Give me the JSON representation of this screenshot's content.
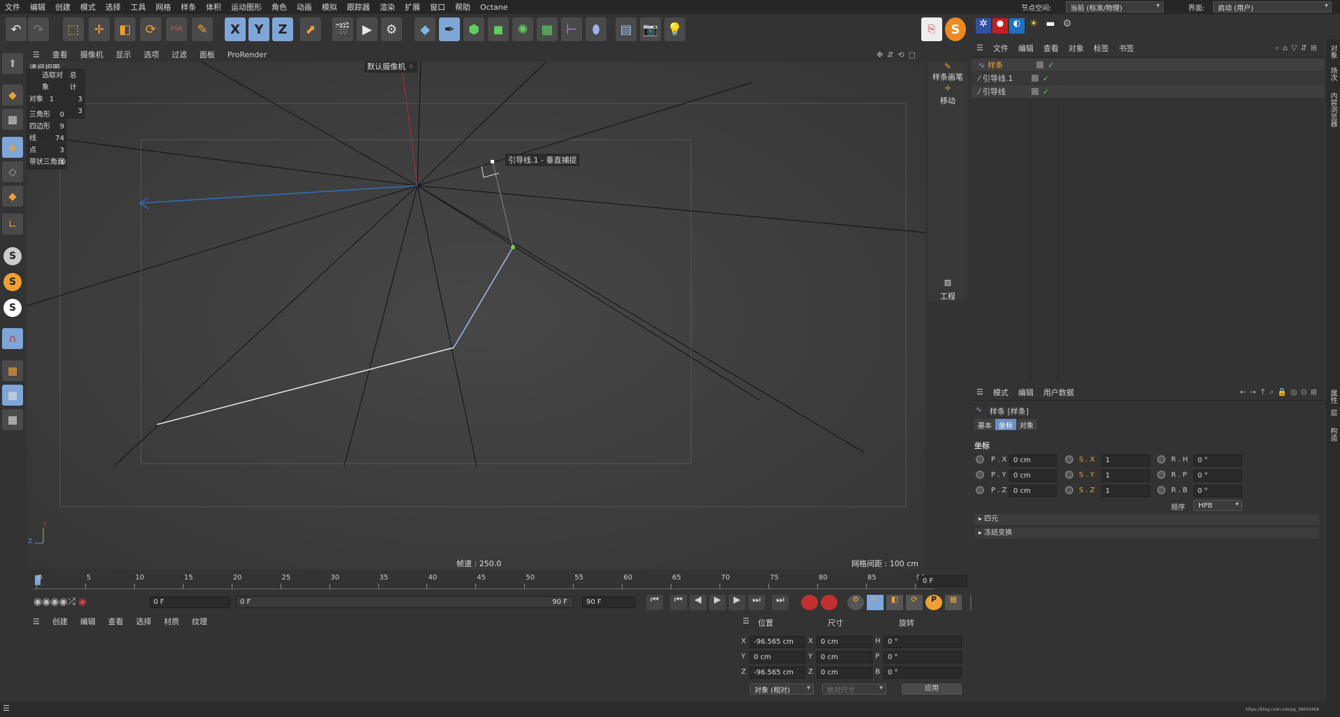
{
  "menubar": {
    "items": [
      "文件",
      "编辑",
      "创建",
      "模式",
      "选择",
      "工具",
      "网格",
      "样条",
      "体积",
      "运动图形",
      "角色",
      "动画",
      "模拟",
      "跟踪器",
      "渲染",
      "扩展",
      "窗口",
      "帮助",
      "Octane"
    ],
    "node_space_label": "节点空间:",
    "node_space_value": "当前 (标准/物理)",
    "layout_label": "界面:",
    "layout_value": "启动 (用户)"
  },
  "toolbar": {
    "icons": [
      "undo-icon",
      "redo-icon",
      "select-icon",
      "move-icon",
      "scale-icon",
      "rotate-icon",
      "psr-icon",
      "spline-pen-icon",
      "x-axis-icon",
      "y-axis-icon",
      "z-axis-icon",
      "coordinate-system-icon",
      "render-view-icon",
      "render-icon",
      "render-settings-icon",
      "cube-icon",
      "pen-icon",
      "subdivision-icon",
      "extrude-icon",
      "cloner-icon",
      "array-icon",
      "deformer-icon",
      "bend-icon",
      "floor-icon",
      "camera-icon",
      "light-icon"
    ],
    "axis_labels": [
      "X",
      "Y",
      "Z"
    ],
    "psr_label": "PSR"
  },
  "viewport": {
    "menu": [
      "查看",
      "摄像机",
      "显示",
      "选项",
      "过滤",
      "面板",
      "ProRender"
    ],
    "view_name": "透视视图",
    "camera_label": "默认摄像机",
    "snap_tooltip": "引导线.1 - 垂直捕捉",
    "fps_label": "帧速 : 250.0",
    "grid_label": "网格间距 : 100 cm",
    "stats_header": [
      "",
      "选取对象",
      "总计"
    ],
    "stats_rows": [
      [
        "对象",
        "1",
        "3"
      ],
      [
        "点",
        "1",
        "3"
      ]
    ],
    "stats2_rows": [
      [
        "三角形",
        "0"
      ],
      [
        "四边形",
        "9"
      ],
      [
        "线",
        "74"
      ],
      [
        "点",
        "3"
      ],
      [
        "带状三角面",
        "0"
      ]
    ]
  },
  "right_strip": {
    "spline_pen": "样条画笔",
    "move": "移动",
    "project": "工程"
  },
  "timeline": {
    "ticks": [
      "0",
      "5",
      "10",
      "15",
      "20",
      "25",
      "30",
      "35",
      "40",
      "45",
      "50",
      "55",
      "60",
      "65",
      "70",
      "75",
      "80",
      "85",
      "90"
    ],
    "current_frame": "0 F",
    "start_frame": "0 F",
    "range_start": "0 F",
    "range_end": "90 F",
    "end_frame": "90 F"
  },
  "material_bar": {
    "items": [
      "创建",
      "编辑",
      "查看",
      "选择",
      "材质",
      "纹理"
    ]
  },
  "coords": {
    "headers": [
      "位置",
      "尺寸",
      "旋转"
    ],
    "rows": [
      {
        "axis": "X",
        "pos": "-96.565 cm",
        "size_axis": "X",
        "size": "0 cm",
        "rot_axis": "H",
        "rot": "0 °"
      },
      {
        "axis": "Y",
        "pos": "0 cm",
        "size_axis": "Y",
        "size": "0 cm",
        "rot_axis": "P",
        "rot": "0 °"
      },
      {
        "axis": "Z",
        "pos": "-96.565 cm",
        "size_axis": "Z",
        "size": "0 cm",
        "rot_axis": "B",
        "rot": "0 °"
      }
    ],
    "mode_select": "对象 (相对)",
    "size_select": "绝对尺寸",
    "apply_button": "应用"
  },
  "object_manager": {
    "menu": [
      "文件",
      "编辑",
      "查看",
      "对象",
      "标签",
      "书签"
    ],
    "objects": [
      {
        "name": "样条",
        "selected": true
      },
      {
        "name": "引导线.1",
        "selected": false
      },
      {
        "name": "引导线",
        "selected": false
      }
    ]
  },
  "attr_manager": {
    "menu": [
      "模式",
      "编辑",
      "用户数据"
    ],
    "object_title": "样条 [样条]",
    "tabs": [
      "基本",
      "坐标",
      "对象"
    ],
    "active_tab": "坐标",
    "section": "坐标",
    "rows": [
      {
        "p_label": "P . X",
        "p": "0 cm",
        "s_label": "S . X",
        "s": "1",
        "r_label": "R . H",
        "r": "0 °"
      },
      {
        "p_label": "P . Y",
        "p": "0 cm",
        "s_label": "S . Y",
        "s": "1",
        "r_label": "R . P",
        "r": "0 °"
      },
      {
        "p_label": "P . Z",
        "p": "0 cm",
        "s_label": "S . Z",
        "s": "1",
        "r_label": "R . B",
        "r": "0 °"
      }
    ],
    "order_label": "顺序",
    "order_value": "HPB",
    "collapsed": [
      "四元",
      "冻结变换"
    ]
  },
  "side_tabs": [
    "对象",
    "场次",
    "内容浏览器",
    "属性",
    "层",
    "构造"
  ],
  "status_url": "https://blog.csdn.net/qq_38659468"
}
